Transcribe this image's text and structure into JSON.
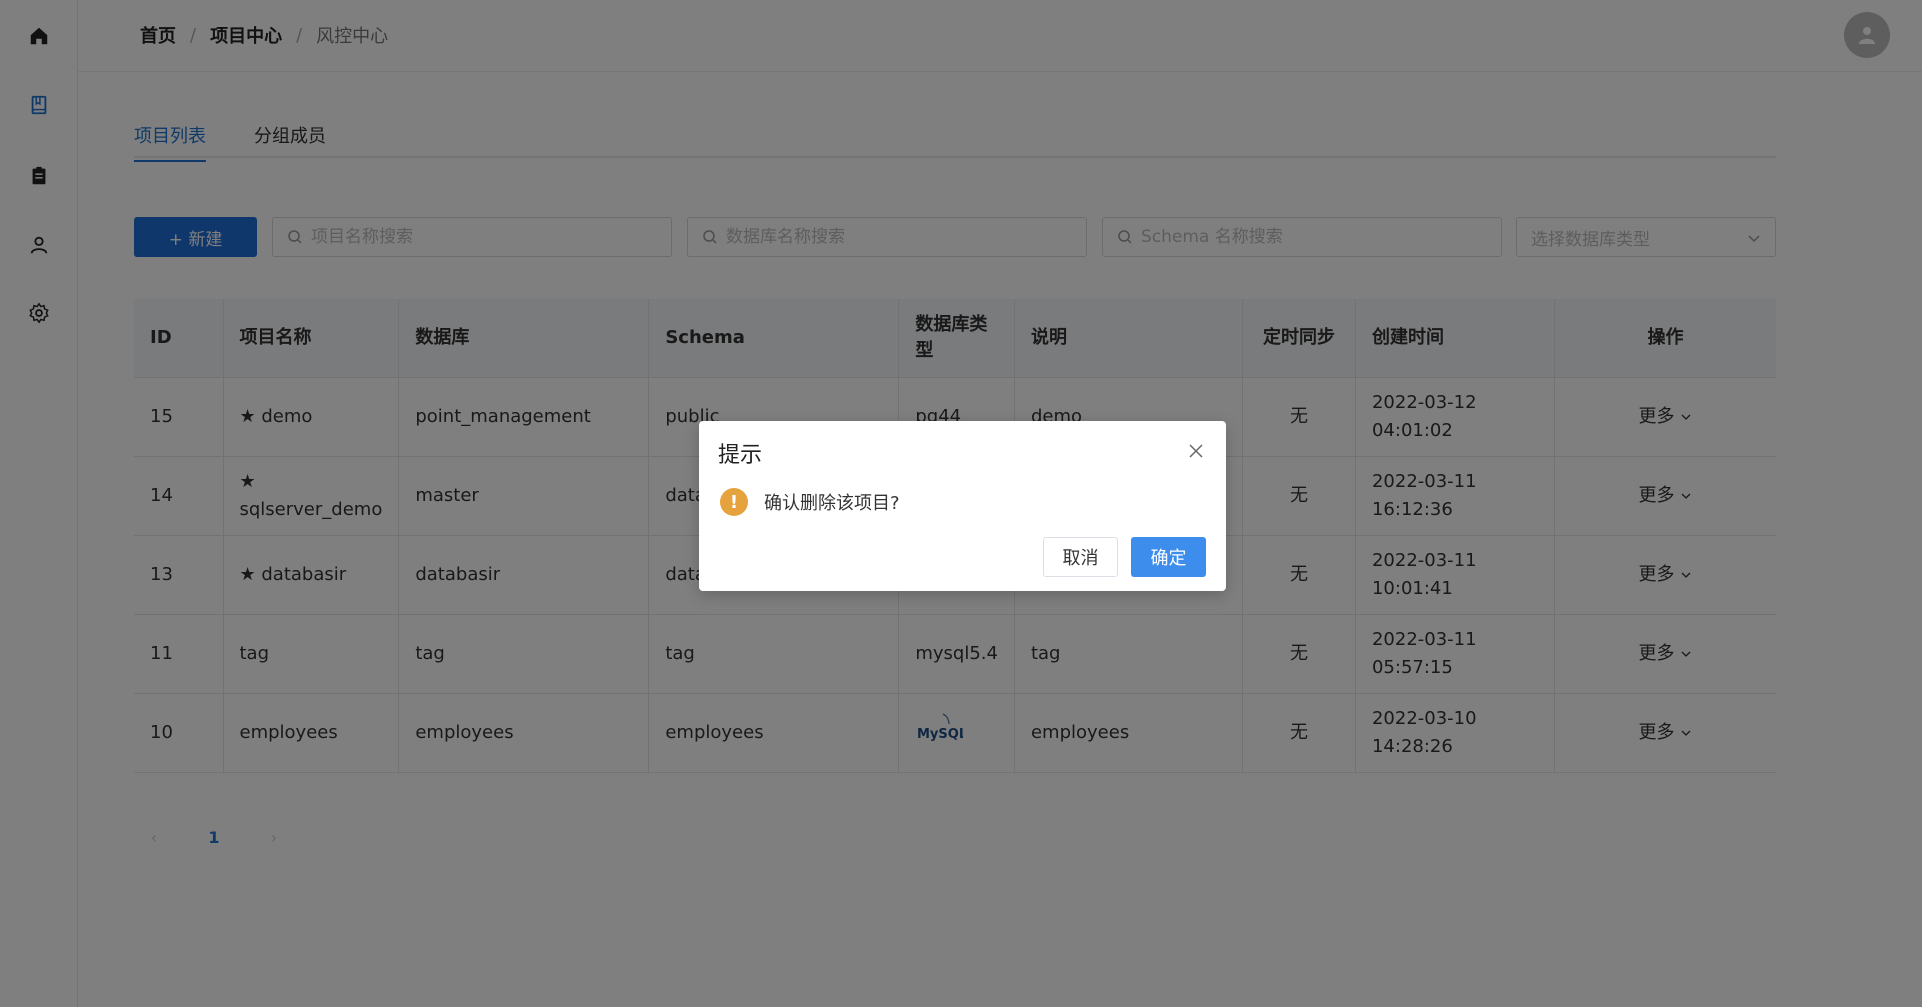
{
  "breadcrumb": {
    "home": "首页",
    "sep": "/",
    "project_center": "项目中心",
    "current": "风控中心"
  },
  "tabs": {
    "project_list": "项目列表",
    "group_members": "分组成员"
  },
  "toolbar": {
    "new_label": "+ 新建",
    "search_project_placeholder": "项目名称搜索",
    "search_db_placeholder": "数据库名称搜索",
    "search_schema_placeholder": "Schema 名称搜索",
    "db_type_placeholder": "选择数据库类型"
  },
  "table": {
    "headers": {
      "id": "ID",
      "name": "项目名称",
      "database": "数据库",
      "schema": "Schema",
      "db_type": "数据库类型",
      "desc": "说明",
      "sync": "定时同步",
      "created": "创建时间",
      "action": "操作"
    },
    "rows": [
      {
        "id": "15",
        "star": "★",
        "name": "demo",
        "database": "point_management",
        "schema": "public",
        "db_type": "pg44",
        "desc": "demo",
        "sync": "无",
        "created": "2022-03-12 04:01:02",
        "action": "更多"
      },
      {
        "id": "14",
        "star": "★",
        "name": "sqlserver_demo",
        "database": "master",
        "schema": "data",
        "db_type": "",
        "desc": "",
        "sync": "无",
        "created": "2022-03-11 16:12:36",
        "action": "更多"
      },
      {
        "id": "13",
        "star": "★",
        "name": "databasir",
        "database": "databasir",
        "schema": "data",
        "db_type": "",
        "desc": "",
        "sync": "无",
        "created": "2022-03-11 10:01:41",
        "action": "更多"
      },
      {
        "id": "11",
        "star": "",
        "name": "tag",
        "database": "tag",
        "schema": "tag",
        "db_type": "mysql5.4",
        "desc": "tag",
        "sync": "无",
        "created": "2022-03-11 05:57:15",
        "action": "更多"
      },
      {
        "id": "10",
        "star": "",
        "name": "employees",
        "database": "employees",
        "schema": "employees",
        "db_type": "MySQL",
        "desc": "employees",
        "sync": "无",
        "created": "2022-03-10 14:28:26",
        "action": "更多"
      }
    ]
  },
  "pagination": {
    "current": "1",
    "prev": "‹",
    "next": "›"
  },
  "dialog": {
    "title": "提示",
    "icon": "!",
    "message": "确认删除该项目?",
    "cancel": "取消",
    "confirm": "确定"
  },
  "colors": {
    "primary": "#1e6fd6",
    "warning": "#e6a23c",
    "mask": "rgba(0,0,0,0.5)"
  }
}
